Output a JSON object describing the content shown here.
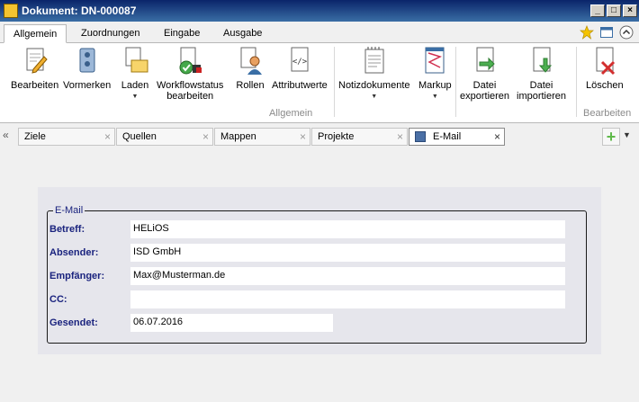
{
  "window": {
    "title": "Dokument: DN-000087"
  },
  "ribbon_tabs": [
    "Allgemein",
    "Zuordnungen",
    "Eingabe",
    "Ausgabe"
  ],
  "ribbon": {
    "buttons": {
      "bearbeiten": "Bearbeiten",
      "vormerken": "Vormerken",
      "laden": "Laden",
      "workflow_line1": "Workflowstatus",
      "workflow_line2": "bearbeiten",
      "rollen": "Rollen",
      "attributwerte": "Attributwerte",
      "notizdokumente": "Notizdokumente",
      "markup": "Markup",
      "export_line1": "Datei",
      "export_line2": "exportieren",
      "import_line1": "Datei",
      "import_line2": "importieren",
      "loeschen": "Löschen"
    },
    "groups": {
      "allgemein": "Allgemein",
      "bearbeiten": "Bearbeiten"
    }
  },
  "doc_tabs": [
    {
      "label": "Ziele"
    },
    {
      "label": "Quellen"
    },
    {
      "label": "Mappen"
    },
    {
      "label": "Projekte"
    },
    {
      "label": "E-Mail",
      "active": true
    }
  ],
  "email": {
    "legend": "E-Mail",
    "fields": [
      {
        "label": "Betreff:",
        "value": "HELiOS"
      },
      {
        "label": "Absender:",
        "value": "ISD GmbH"
      },
      {
        "label": "Empfänger:",
        "value": "Max@Musterman.de"
      },
      {
        "label": "CC:",
        "value": ""
      },
      {
        "label": "Gesendet:",
        "value": "06.07.2016"
      }
    ]
  },
  "colors": {
    "titlebar": "#0a246a",
    "label": "#1a237e",
    "accent_green": "#5fb94a"
  },
  "icons": {
    "window_controls": [
      "minimize-icon",
      "maximize-icon",
      "close-icon"
    ],
    "ribbon_right": [
      "star-icon",
      "window-icon",
      "collapse-icon"
    ]
  }
}
